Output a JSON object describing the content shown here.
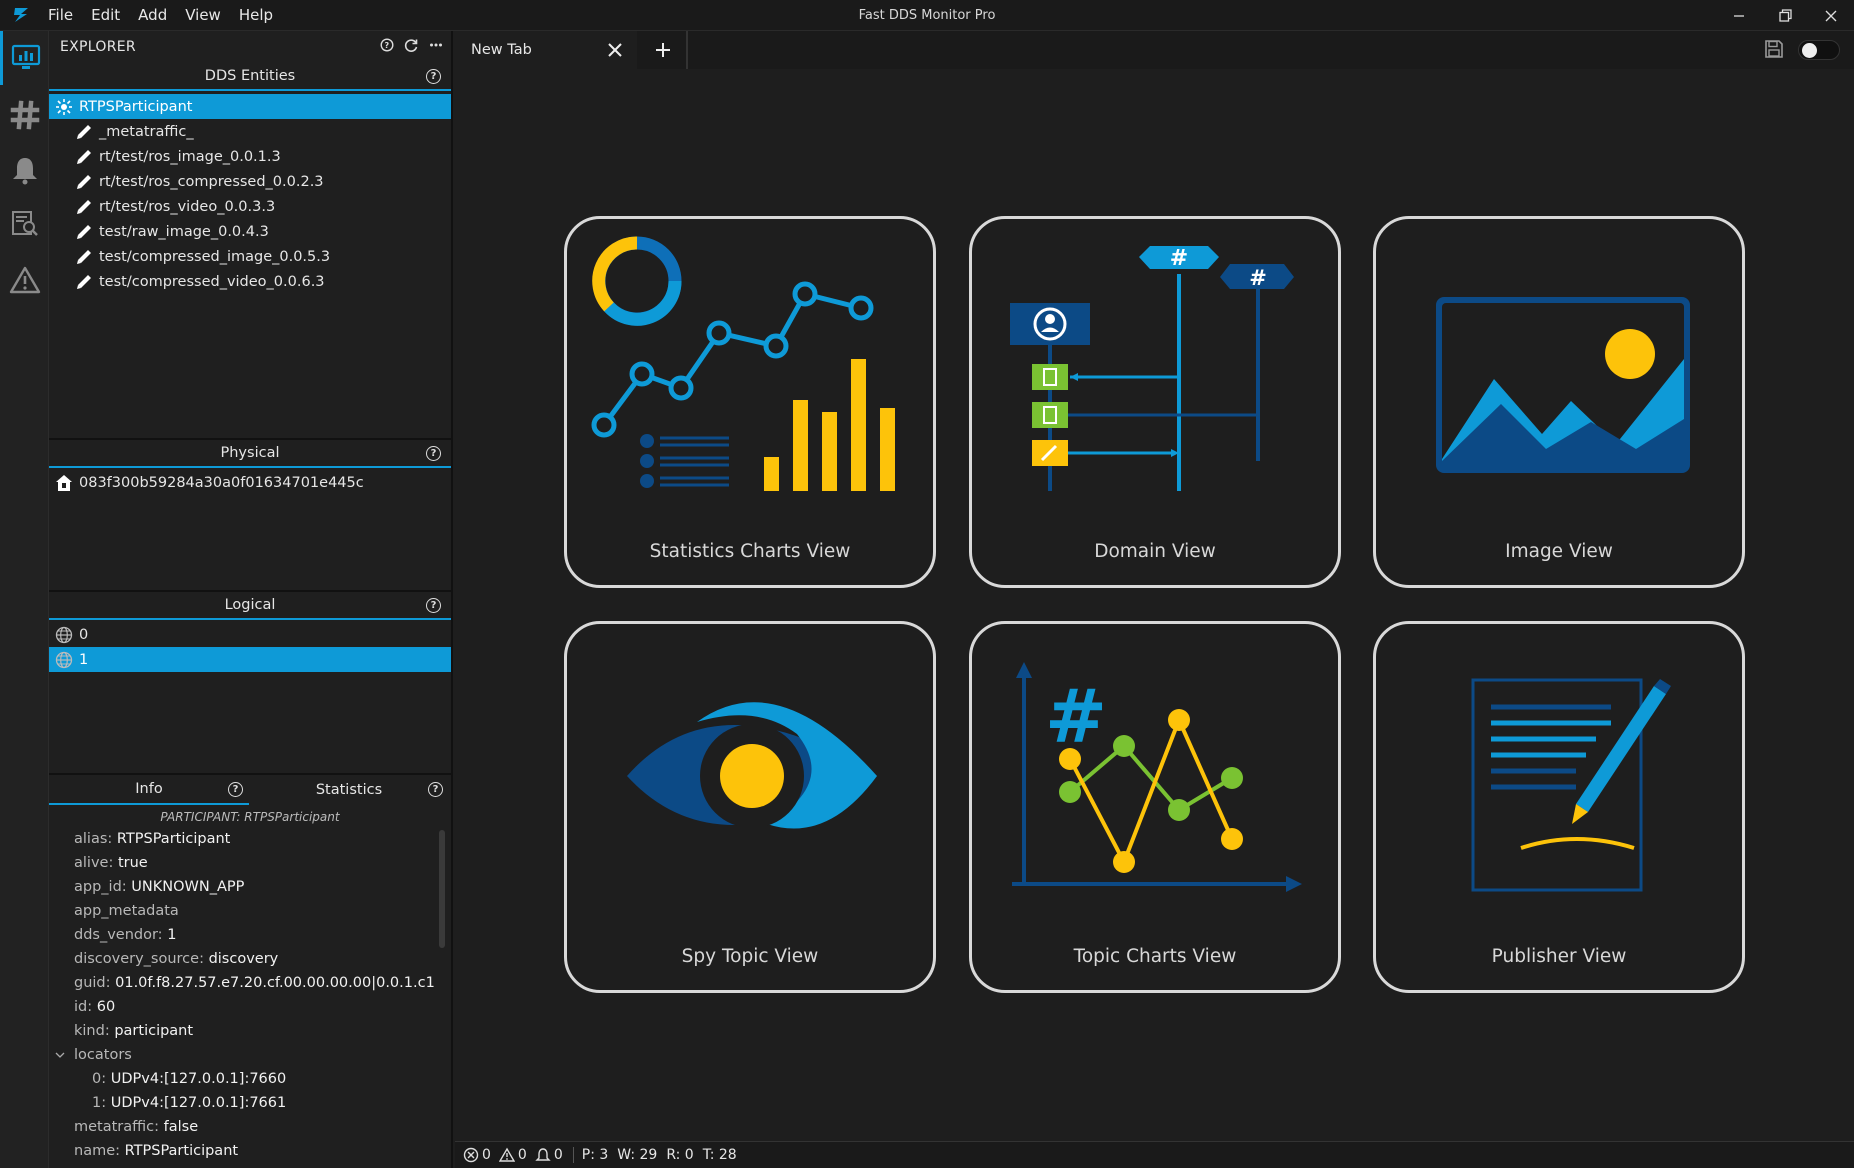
{
  "window": {
    "title": "Fast DDS Monitor Pro"
  },
  "menu": [
    "File",
    "Edit",
    "Add",
    "View",
    "Help"
  ],
  "explorer": {
    "title": "EXPLORER",
    "dds_entities": {
      "title": "DDS Entities",
      "items": [
        {
          "label": "RTPSParticipant",
          "icon": "participant-icon",
          "selected": true
        },
        {
          "label": "_metatraffic_",
          "icon": "pen-icon"
        },
        {
          "label": "rt/test/ros_image_0.0.1.3",
          "icon": "pen-icon"
        },
        {
          "label": "rt/test/ros_compressed_0.0.2.3",
          "icon": "pen-icon"
        },
        {
          "label": "rt/test/ros_video_0.0.3.3",
          "icon": "pen-icon"
        },
        {
          "label": "test/raw_image_0.0.4.3",
          "icon": "pen-icon"
        },
        {
          "label": "test/compressed_image_0.0.5.3",
          "icon": "pen-icon"
        },
        {
          "label": "test/compressed_video_0.0.6.3",
          "icon": "pen-icon"
        }
      ]
    },
    "physical": {
      "title": "Physical",
      "items": [
        {
          "label": "083f300b59284a30a0f01634701e445c",
          "icon": "host-icon"
        }
      ]
    },
    "logical": {
      "title": "Logical",
      "items": [
        {
          "label": "0",
          "icon": "globe-icon"
        },
        {
          "label": "1",
          "icon": "globe-icon",
          "selected": true
        }
      ]
    },
    "info": {
      "tabs": [
        "Info",
        "Statistics"
      ],
      "subtitle": "PARTICIPANT: RTPSParticipant",
      "properties": [
        {
          "key": "alias: ",
          "value": "RTPSParticipant"
        },
        {
          "key": "alive: ",
          "value": "true"
        },
        {
          "key": "app_id: ",
          "value": "UNKNOWN_APP"
        },
        {
          "key": "app_metadata",
          "value": ""
        },
        {
          "key": "dds_vendor: ",
          "value": "1"
        },
        {
          "key": "discovery_source: ",
          "value": "discovery"
        },
        {
          "key": "guid: ",
          "value": "01.0f.f8.27.57.e7.20.cf.00.00.00.00|0.0.1.c1"
        },
        {
          "key": "id: ",
          "value": "60"
        },
        {
          "key": "kind: ",
          "value": "participant"
        },
        {
          "key": "locators",
          "value": ""
        },
        {
          "key": "0: ",
          "value": "UDPv4:[127.0.0.1]:7660"
        },
        {
          "key": "1: ",
          "value": "UDPv4:[127.0.0.1]:7661"
        },
        {
          "key": "metatraffic: ",
          "value": "false"
        },
        {
          "key": "name: ",
          "value": "RTPSParticipant"
        }
      ]
    }
  },
  "tabs": {
    "active_label": "New Tab"
  },
  "views": [
    {
      "label": "Statistics Charts View",
      "icon": "statistics-chart-icon"
    },
    {
      "label": "Domain View",
      "icon": "domain-graph-icon"
    },
    {
      "label": "Image View",
      "icon": "image-icon"
    },
    {
      "label": "Spy Topic View",
      "icon": "eye-icon"
    },
    {
      "label": "Topic Charts View",
      "icon": "topic-chart-icon"
    },
    {
      "label": "Publisher View",
      "icon": "publisher-pen-icon"
    }
  ],
  "statusbar": {
    "errors": "0",
    "warnings": "0",
    "notifications": "0",
    "participants": "P: 3",
    "writers": "W: 29",
    "readers": "R: 0",
    "topics": "T: 28"
  },
  "colors": {
    "accent": "#0e9ad7",
    "yellow": "#fdc30a",
    "dark_blue": "#0c4a86",
    "green": "#7ac232"
  }
}
